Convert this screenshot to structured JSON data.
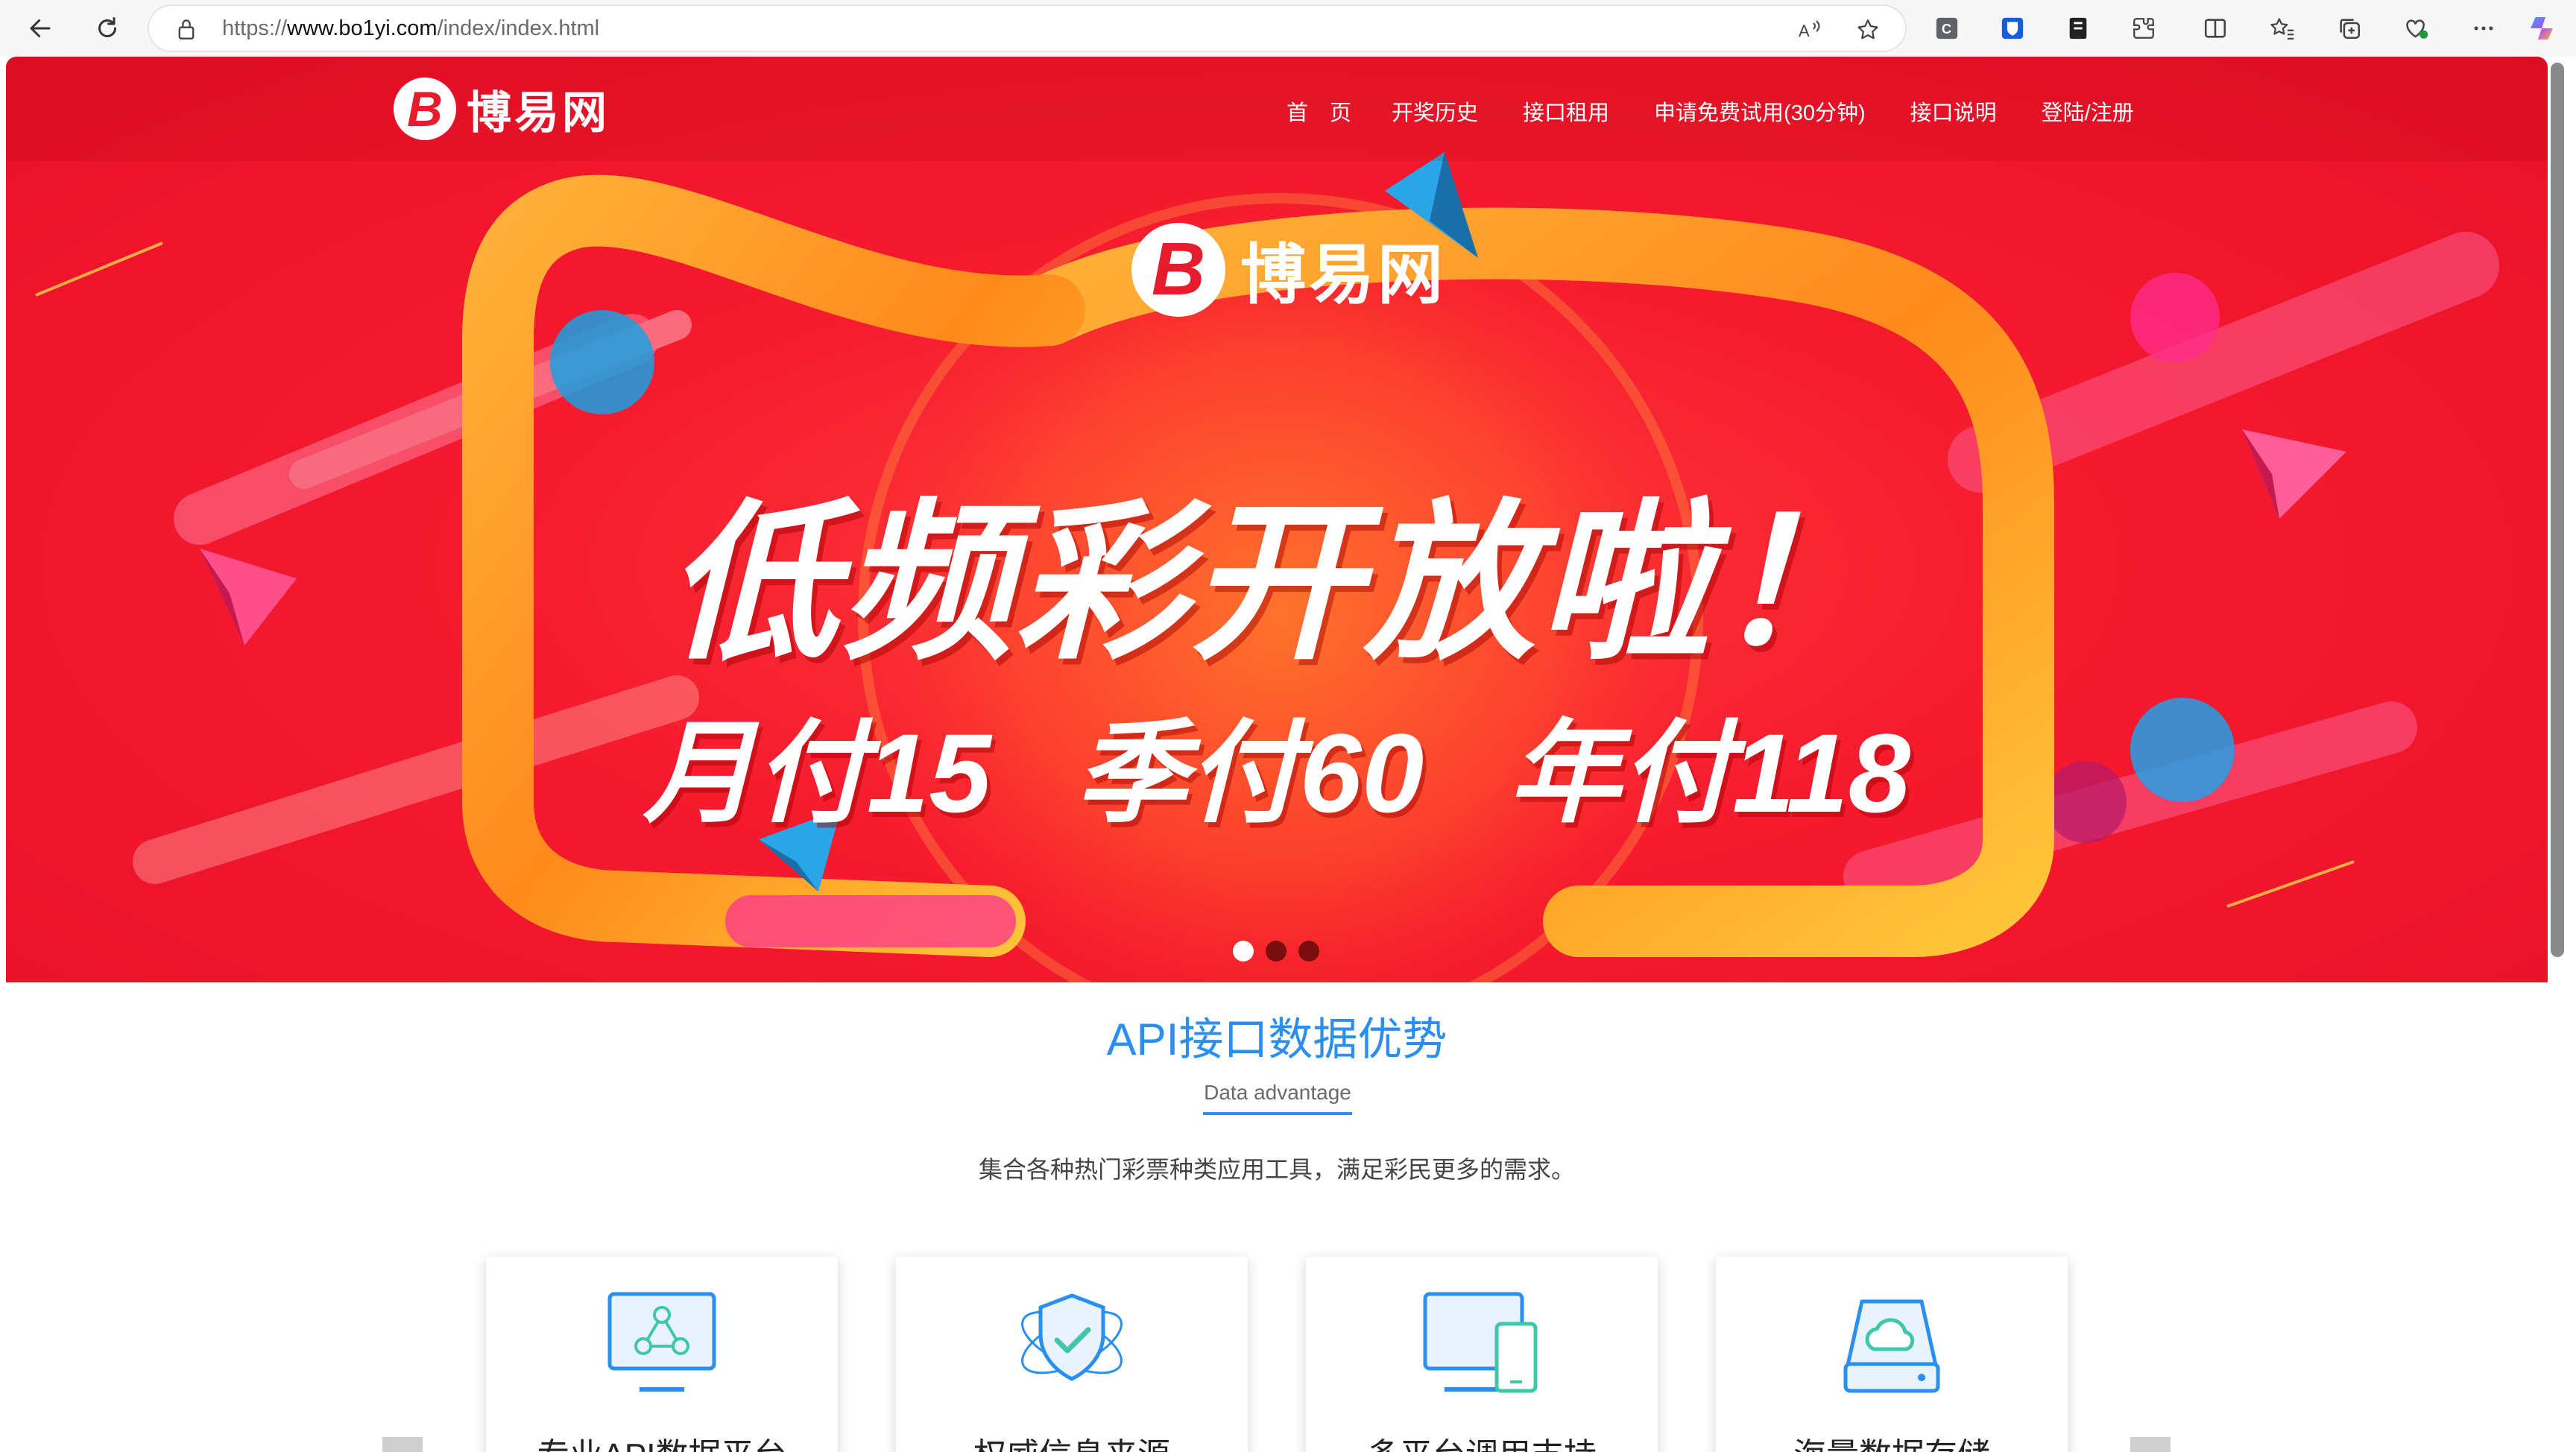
{
  "browser": {
    "url_scheme": "https://",
    "url_host": "www.bo1yi.com",
    "url_path": "/index/index.html",
    "icons": [
      "back-icon",
      "refresh-icon",
      "lock-icon",
      "read-aloud-icon",
      "favorite-star-icon",
      "extension-c-icon",
      "bitwarden-icon",
      "extension-doc-icon",
      "extensions-puzzle-icon",
      "split-screen-icon",
      "favorites-icon",
      "collections-icon",
      "browser-essentials-icon",
      "more-icon",
      "copilot-icon"
    ]
  },
  "site": {
    "logo_name": "博易网",
    "logo_letter": "B",
    "nav": [
      "首　页",
      "开奖历史",
      "接口租用",
      "申请免费试用(30分钟)",
      "接口说明",
      "登陆/注册"
    ]
  },
  "hero": {
    "logo_name": "博易网",
    "logo_letter": "B",
    "headline": "低频彩开放啦！",
    "prices": [
      "月付15",
      "季付60",
      "年付118"
    ],
    "slide_count": 3,
    "active_slide": 1,
    "colors": {
      "bg": "#f51a2e",
      "ribbon": "#ff9a1a",
      "accent_blue": "#23a0e8"
    }
  },
  "section": {
    "title": "API接口数据优势",
    "subtitle": "Data advantage",
    "description": "集合各种热门彩票种类应用工具，满足彩民更多的需求。",
    "cards": [
      {
        "title": "专业API数据平台",
        "icon": "network-monitor-icon"
      },
      {
        "title": "权威信息来源",
        "icon": "shield-check-icon"
      },
      {
        "title": "多平台调用支持",
        "icon": "devices-icon"
      },
      {
        "title": "海量数据存储",
        "icon": "cloud-storage-icon"
      }
    ],
    "accent": "#2a8ff0"
  }
}
